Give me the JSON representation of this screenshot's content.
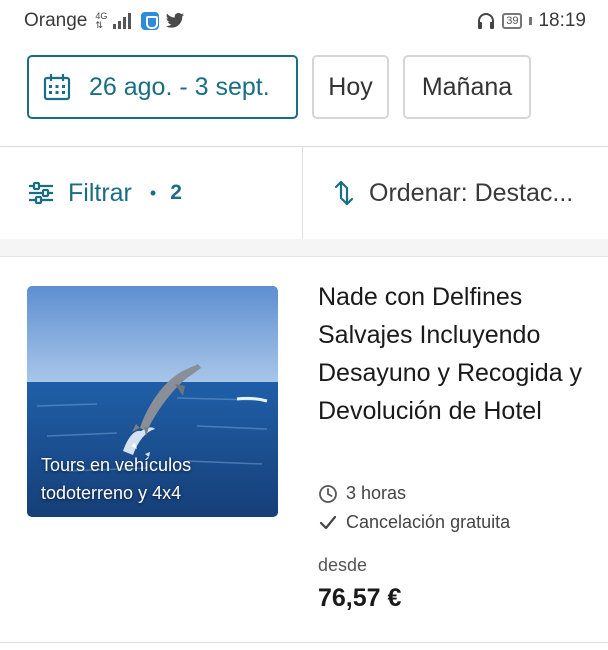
{
  "status_bar": {
    "carrier": "Orange",
    "network_top": "4G",
    "network_bottom": "⇅",
    "battery": "39",
    "time": "18:19"
  },
  "date_filter": {
    "range_label": "26 ago. - 3 sept.",
    "today_label": "Hoy",
    "tomorrow_label": "Mañana",
    "accent_color": "#1a6e83"
  },
  "toolbar": {
    "filter_label": "Filtrar",
    "filter_dot": "•",
    "filter_count": "2",
    "sort_label": "Ordenar: Destac..."
  },
  "listing": {
    "image_caption_line1": "Tours en vehículos",
    "image_caption_line2": "todoterreno y 4x4",
    "title": "Nade con Delfines Salvajes Incluyendo Desayuno y Recogida y Devolución de Hotel",
    "duration": "3 horas",
    "cancellation": "Cancelación gratuita",
    "price_prefix": "desde",
    "price": "76,57 €"
  },
  "icons": {
    "calendar": "calendar-icon",
    "filter": "sliders-icon",
    "sort": "sort-arrows-icon",
    "clock": "clock-icon",
    "check": "checkmark-icon"
  }
}
